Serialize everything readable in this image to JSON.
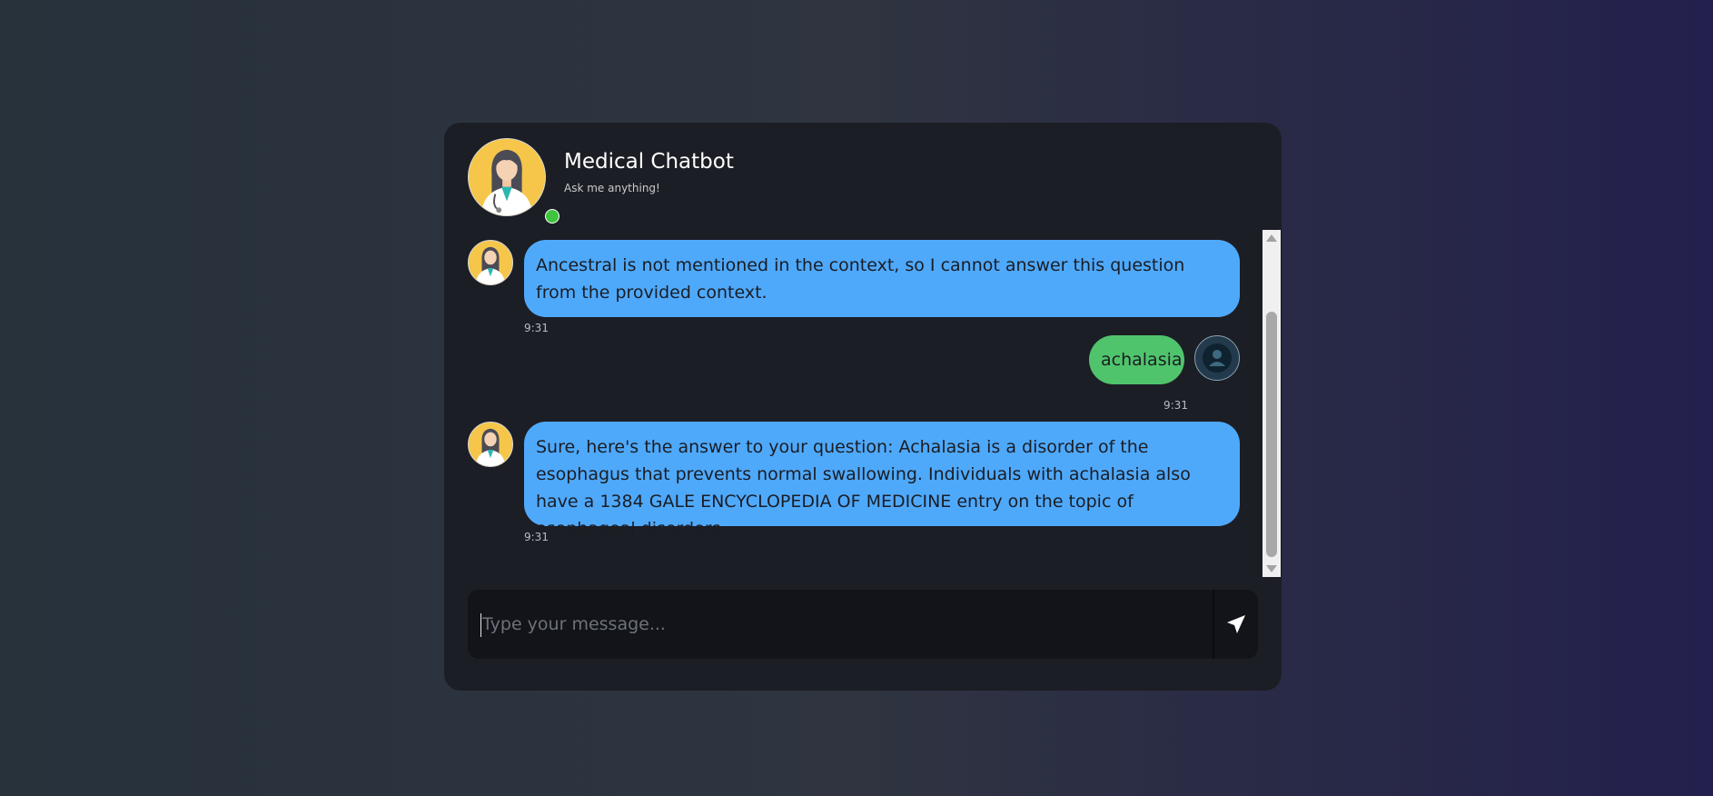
{
  "header": {
    "title": "Medical Chatbot",
    "subtitle": "Ask me anything!",
    "status": "online"
  },
  "messages": [
    {
      "sender": "bot",
      "text": "Ancestral is not mentioned in the context, so I cannot answer this question from the provided context.",
      "time": "9:31"
    },
    {
      "sender": "user",
      "text": "achalasia",
      "time": "9:31"
    },
    {
      "sender": "bot",
      "text": "Sure, here's the answer to your question: Achalasia is a disorder of the esophagus that prevents normal swallowing. Individuals with achalasia also have a 1384 GALE ENCYCLOPEDIA OF MEDICINE entry on the topic of esophageal disorders.",
      "time": "9:31"
    }
  ],
  "composer": {
    "placeholder": "Type your message...",
    "value": "",
    "send_icon": "send-arrow-icon"
  },
  "colors": {
    "bot_bubble": "#4fa9fb",
    "user_bubble": "#50c46c",
    "online": "#3ec43e",
    "card": "#1c1e25"
  }
}
